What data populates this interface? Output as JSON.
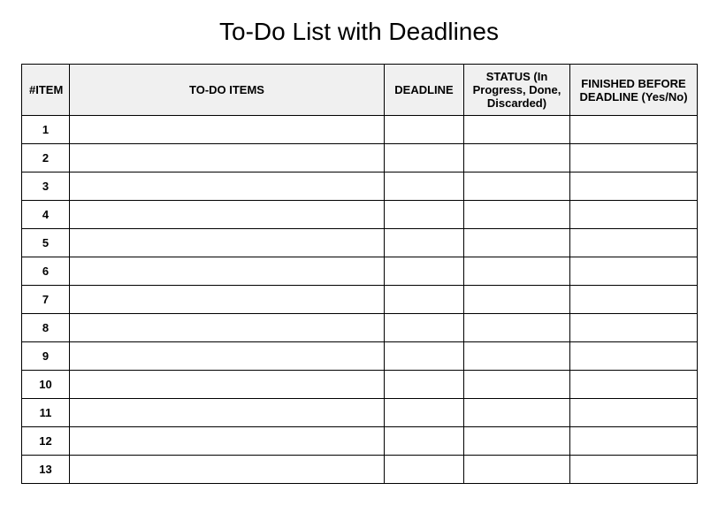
{
  "title": "To-Do List with Deadlines",
  "headers": {
    "item_num": "#ITEM",
    "todo": "TO-DO ITEMS",
    "deadline": "DEADLINE",
    "status": "STATUS (In Progress, Done, Discarded)",
    "finished": "FINISHED BEFORE DEADLINE (Yes/No)"
  },
  "rows": [
    {
      "num": "1",
      "todo": "",
      "deadline": "",
      "status": "",
      "finished": ""
    },
    {
      "num": "2",
      "todo": "",
      "deadline": "",
      "status": "",
      "finished": ""
    },
    {
      "num": "3",
      "todo": "",
      "deadline": "",
      "status": "",
      "finished": ""
    },
    {
      "num": "4",
      "todo": "",
      "deadline": "",
      "status": "",
      "finished": ""
    },
    {
      "num": "5",
      "todo": "",
      "deadline": "",
      "status": "",
      "finished": ""
    },
    {
      "num": "6",
      "todo": "",
      "deadline": "",
      "status": "",
      "finished": ""
    },
    {
      "num": "7",
      "todo": "",
      "deadline": "",
      "status": "",
      "finished": ""
    },
    {
      "num": "8",
      "todo": "",
      "deadline": "",
      "status": "",
      "finished": ""
    },
    {
      "num": "9",
      "todo": "",
      "deadline": "",
      "status": "",
      "finished": ""
    },
    {
      "num": "10",
      "todo": "",
      "deadline": "",
      "status": "",
      "finished": ""
    },
    {
      "num": "11",
      "todo": "",
      "deadline": "",
      "status": "",
      "finished": ""
    },
    {
      "num": "12",
      "todo": "",
      "deadline": "",
      "status": "",
      "finished": ""
    },
    {
      "num": "13",
      "todo": "",
      "deadline": "",
      "status": "",
      "finished": ""
    }
  ]
}
